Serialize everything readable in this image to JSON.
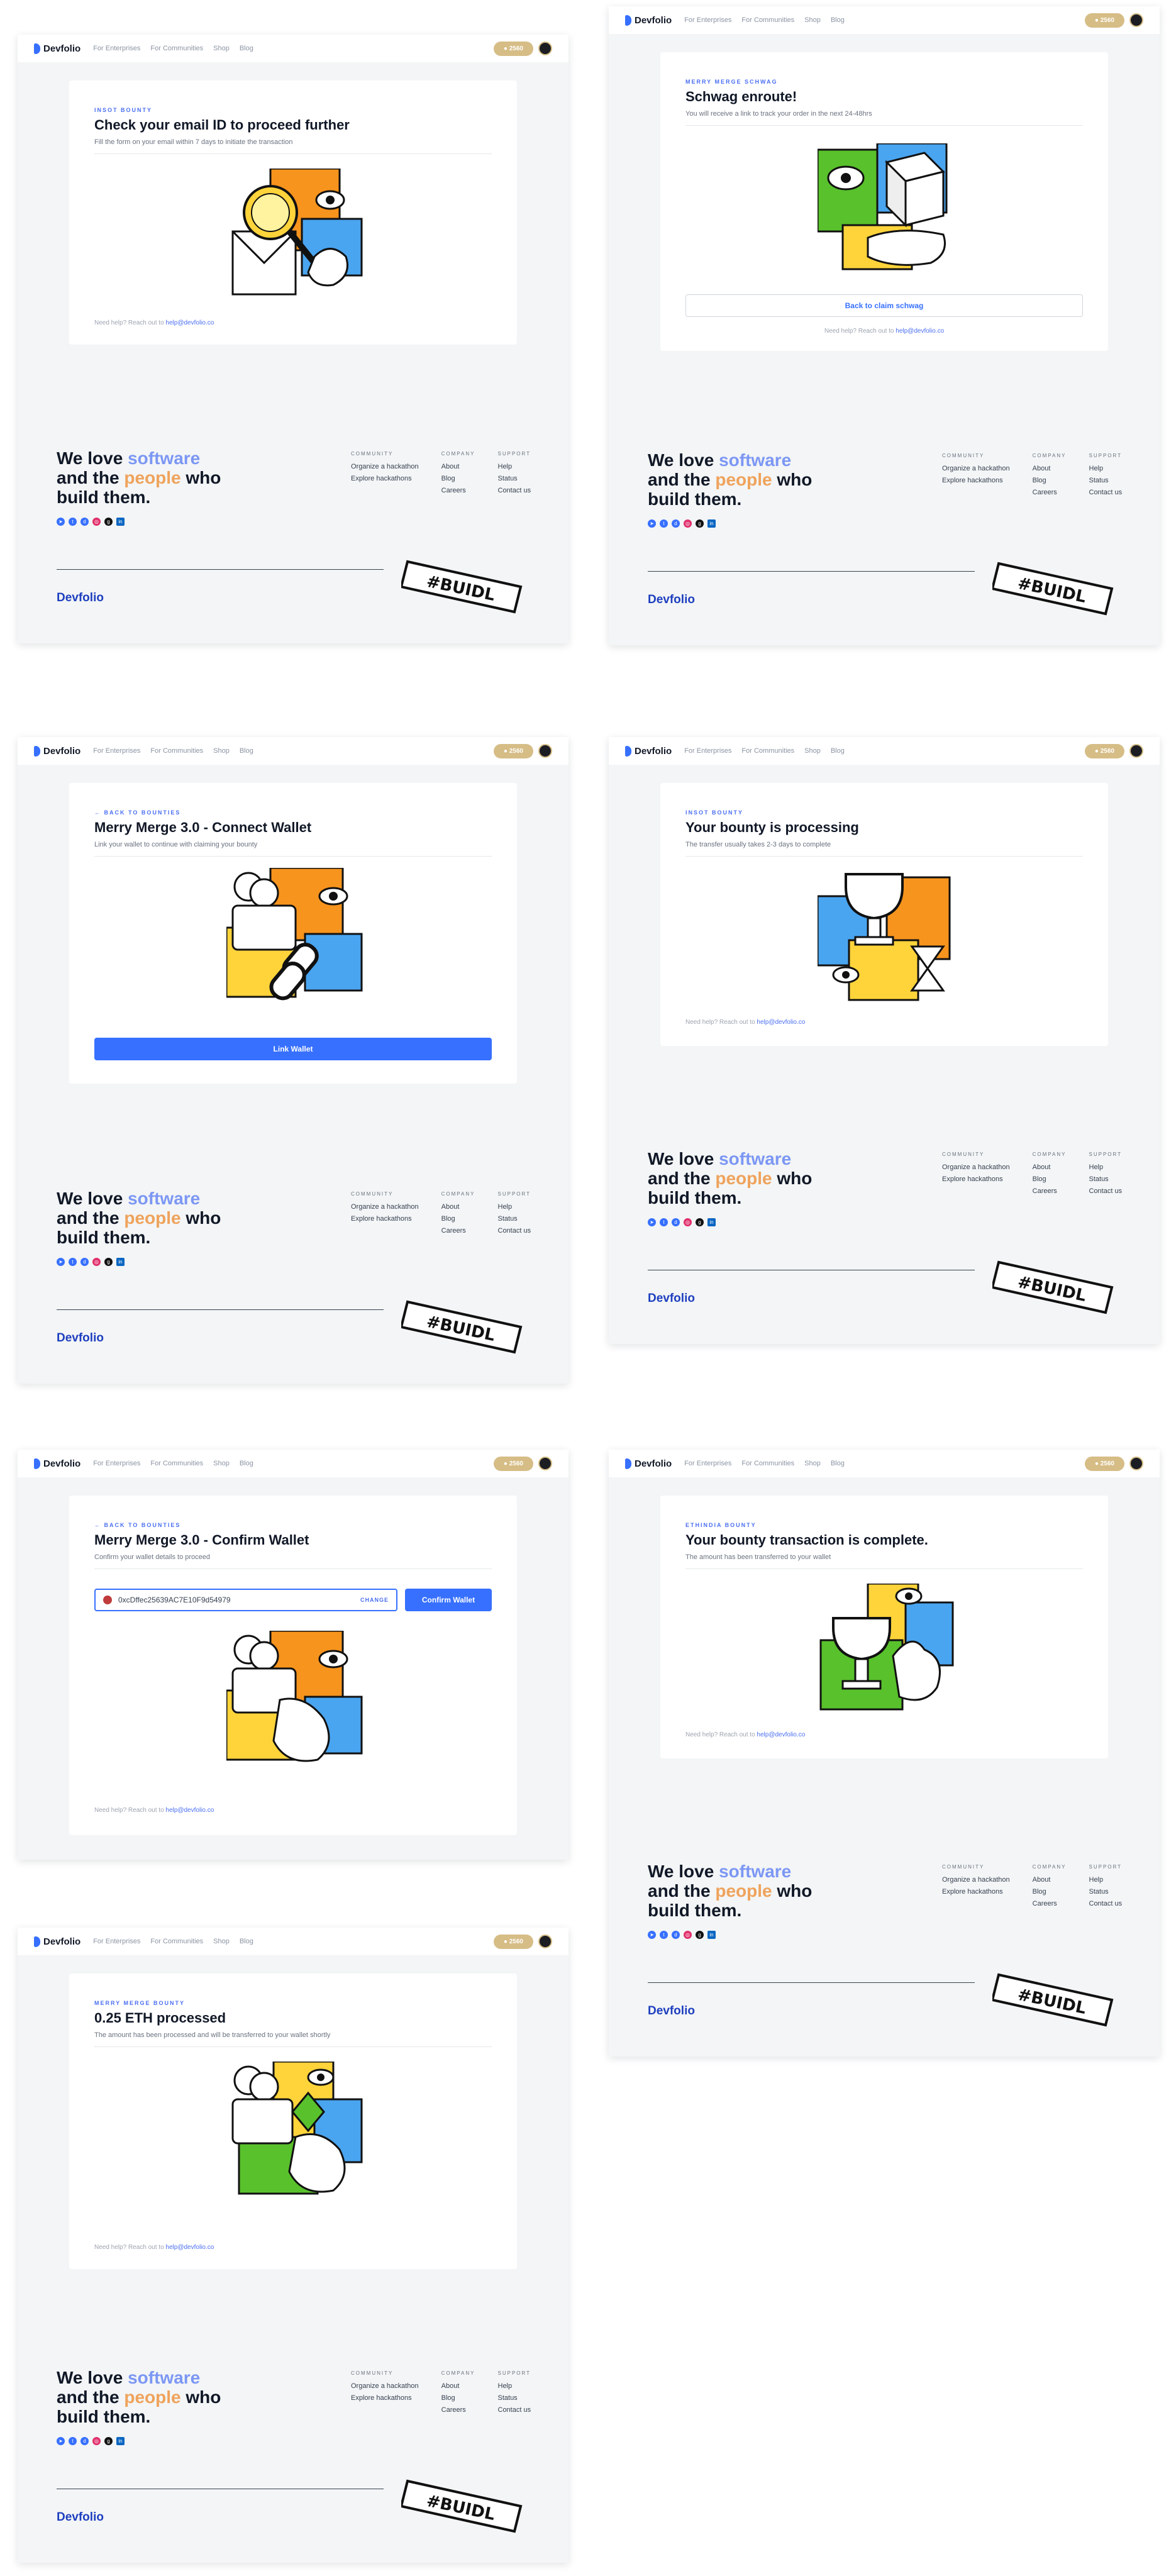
{
  "nav": {
    "brand": "Devfolio",
    "links": [
      "For Enterprises",
      "For Communities",
      "Shop",
      "Blog"
    ],
    "points": "● 2560"
  },
  "screens": [
    {
      "eyebrow": "INSOT BOUNTY",
      "title": "Check your email ID to proceed further",
      "subtitle": "Fill the form on your email within 7 days to initiate the transaction",
      "help_prefix": "Need help? Reach out to ",
      "help_email": "help@devfolio.co"
    },
    {
      "eyebrow": "MERRY MERGE SCHWAG",
      "title": "Schwag enroute!",
      "subtitle": "You will receive a link to track your order in the next 24-48hrs",
      "button": "Back to claim schwag",
      "help_prefix": "Need help? Reach out to ",
      "help_email": "help@devfolio.co"
    },
    {
      "eyebrow": "← BACK TO BOUNTIES",
      "title": "Merry Merge 3.0 - Connect Wallet",
      "subtitle": "Link your wallet to continue with claiming your bounty",
      "button": "Link Wallet"
    },
    {
      "eyebrow": "INSOT BOUNTY",
      "title": "Your bounty is processing",
      "subtitle": "The transfer usually takes 2-3 days to complete",
      "help_prefix": "Need help? Reach out to ",
      "help_email": "help@devfolio.co"
    },
    {
      "eyebrow": "← BACK TO BOUNTIES",
      "title": "Merry Merge 3.0 - Confirm Wallet",
      "subtitle": "Confirm your wallet details to proceed",
      "wallet_address": "0xcDffec25639AC7E10F9d54979",
      "change_label": "CHANGE",
      "button": "Confirm Wallet",
      "help_prefix": "Need help? Reach out to ",
      "help_email": "help@devfolio.co"
    },
    {
      "eyebrow": "ETHINDIA BOUNTY",
      "title": "Your bounty transaction is complete.",
      "subtitle": "The amount has been transferred to your wallet",
      "help_prefix": "Need help? Reach out to ",
      "help_email": "help@devfolio.co"
    },
    {
      "eyebrow": "MERRY MERGE BOUNTY",
      "title": "0.25 ETH processed",
      "subtitle": "The amount has been processed and will be transferred to your wallet shortly",
      "help_prefix": "Need help? Reach out to ",
      "help_email": "help@devfolio.co"
    }
  ],
  "footer": {
    "line1": "We love ",
    "software": "software",
    "line2a": "and the ",
    "people": "people",
    "line2b": " who",
    "line3": "build them.",
    "community_heading": "COMMUNITY",
    "community_items": [
      "Organize a hackathon",
      "Explore hackathons"
    ],
    "company_heading": "COMPANY",
    "company_items": [
      "About",
      "Blog",
      "Careers"
    ],
    "support_heading": "SUPPORT",
    "support_items": [
      "Help",
      "Status",
      "Contact us"
    ],
    "logo": "Devfolio",
    "stamp_text": "#BUIDL"
  },
  "colors": {
    "accent": "#3770ff",
    "gold": "#d6bd86",
    "orange": "#f7941d",
    "yellow": "#ffd43b",
    "sky": "#4aa5f0",
    "green": "#59c12c"
  }
}
